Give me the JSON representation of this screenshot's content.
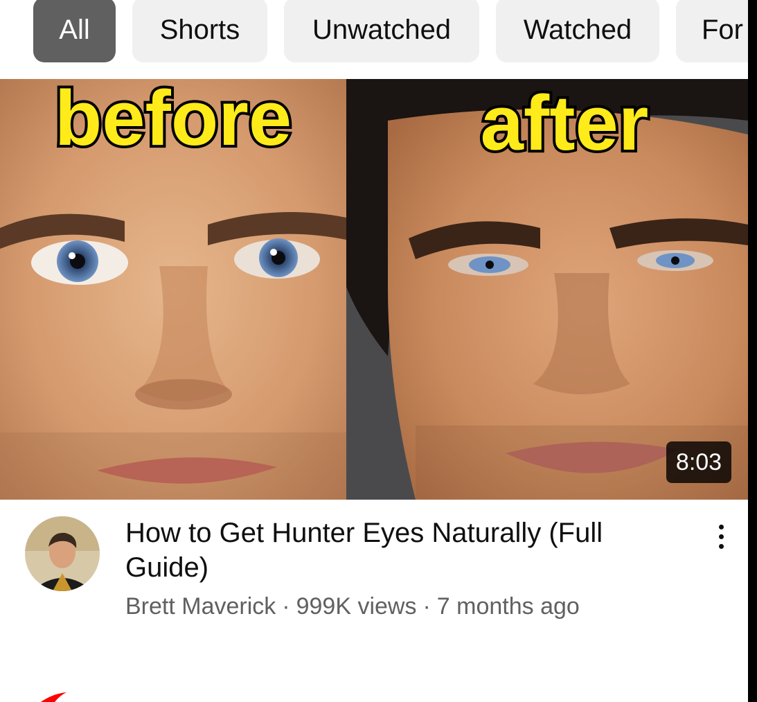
{
  "chips": {
    "items": [
      {
        "label": "All",
        "active": true
      },
      {
        "label": "Shorts",
        "active": false
      },
      {
        "label": "Unwatched",
        "active": false
      },
      {
        "label": "Watched",
        "active": false
      },
      {
        "label": "For",
        "active": false
      }
    ]
  },
  "video": {
    "thumbnail": {
      "left_caption": "before",
      "right_caption": "after",
      "duration": "8:03",
      "caption_color": "#ffeb1a"
    },
    "title": "How to Get Hunter Eyes Naturally (Full Guide)",
    "channel": "Brett Maverick",
    "separator": "·",
    "views": "999K views",
    "age": "7 months ago",
    "menu_icon": "more-vertical-icon"
  },
  "colors": {
    "chip_active_bg": "#606060",
    "chip_bg": "#f0f0f0",
    "text_primary": "#0f0f0f",
    "text_secondary": "#606060"
  }
}
